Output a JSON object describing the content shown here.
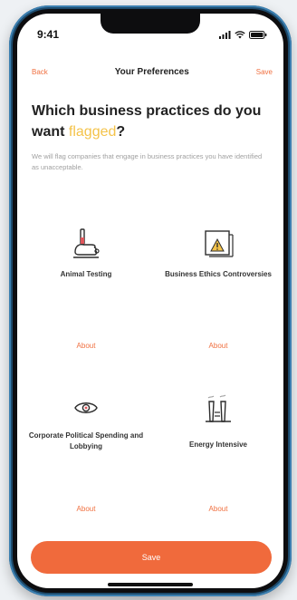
{
  "status_bar": {
    "time": "9:41"
  },
  "nav": {
    "back": "Back",
    "title": "Your Preferences",
    "save": "Save"
  },
  "heading": {
    "part1": "Which business practices do you want ",
    "highlight": "flagged",
    "part2": "?"
  },
  "subtitle": "We will flag companies that engage in business practices you have identified as unacceptable.",
  "practices": [
    {
      "label": "Animal Testing",
      "about": "About",
      "icon": "flask-hand-icon"
    },
    {
      "label": "Business Ethics Controversies",
      "about": "About",
      "icon": "warning-document-icon"
    },
    {
      "label": "Corporate Political Spending and Lobbying",
      "about": "About",
      "icon": "eye-icon"
    },
    {
      "label": "Energy Intensive",
      "about": "About",
      "icon": "factory-icon"
    }
  ],
  "save_button": "Save",
  "colors": {
    "accent": "#f06a3c",
    "highlight": "#f4c34a",
    "warning": "#f4c34a"
  }
}
